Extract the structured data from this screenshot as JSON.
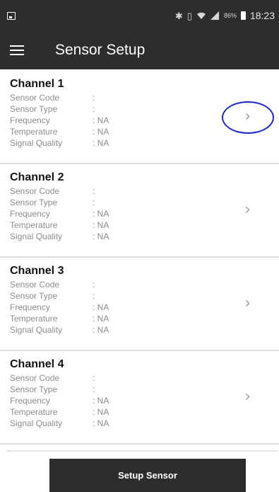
{
  "status_bar": {
    "icons": [
      "gallery-icon",
      "bluetooth-icon",
      "vibrate-icon",
      "wifi-icon",
      "signal-icon",
      "battery-icon"
    ],
    "battery": "86%",
    "time": "18:23"
  },
  "toolbar": {
    "title": "Sensor Setup",
    "menu_icon": "hamburger-menu-icon"
  },
  "labels": {
    "sensor_code": "Sensor Code",
    "sensor_type": "Sensor Type",
    "frequency": "Frequency",
    "temperature": "Temperature",
    "signal_quality": "Signal Quality"
  },
  "channels": [
    {
      "title": "Channel 1",
      "sensor_code": ":",
      "sensor_type": ":",
      "frequency": ": NA",
      "temperature": ": NA",
      "signal_quality": ": NA"
    },
    {
      "title": "Channel 2",
      "sensor_code": ":",
      "sensor_type": ":",
      "frequency": ": NA",
      "temperature": ": NA",
      "signal_quality": ": NA"
    },
    {
      "title": "Channel 3",
      "sensor_code": ":",
      "sensor_type": ":",
      "frequency": ": NA",
      "temperature": ": NA",
      "signal_quality": ": NA"
    },
    {
      "title": "Channel 4",
      "sensor_code": ":",
      "sensor_type": ":",
      "frequency": ": NA",
      "temperature": ": NA",
      "signal_quality": ": NA"
    }
  ],
  "chevron": "›",
  "setup_button": {
    "label": "Setup Sensor"
  },
  "colors": {
    "bar": "#2d2d2d",
    "highlight": "#1d27c9",
    "label_gray": "#8c8c8c"
  }
}
